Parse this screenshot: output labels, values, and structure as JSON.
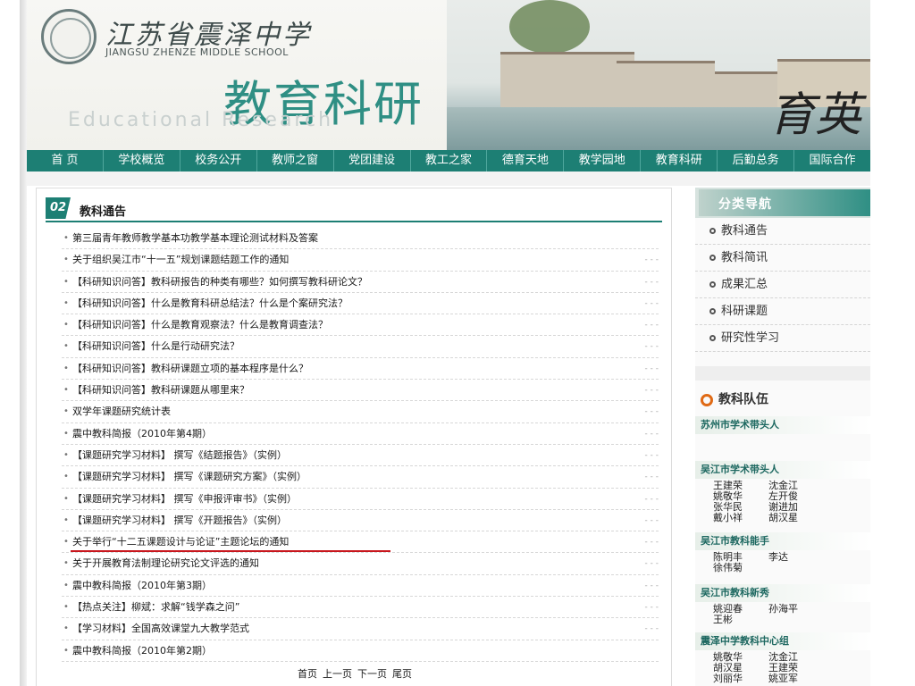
{
  "header": {
    "school_name_cn": "江苏省震泽中学",
    "school_name_en": "JIANGSU ZHENZE MIDDLE SCHOOL",
    "section_title_cn": "教育科研",
    "section_title_en": "Educational Research",
    "art_text": "育英"
  },
  "nav": {
    "items": [
      "首 页",
      "学校概览",
      "校务公开",
      "教师之窗",
      "党团建设",
      "教工之家",
      "德育天地",
      "教学园地",
      "教育科研",
      "后勤总务",
      "国际合作"
    ]
  },
  "main": {
    "badge": "02",
    "title": "教科通告",
    "items": [
      "第三届青年教师教学基本功教学基本理论测试材料及答案",
      "关于组织吴江市“十一五”规划课题结题工作的通知",
      "【科研知识问答】教科研报告的种类有哪些？如何撰写教科研论文？",
      "【科研知识问答】什么是教育科研总结法？什么是个案研究法？",
      "【科研知识问答】什么是教育观察法？什么是教育调查法？",
      "【科研知识问答】什么是行动研究法？",
      "【科研知识问答】教科研课题立项的基本程序是什么？",
      "【科研知识问答】教科研课题从哪里来？",
      "双学年课题研究统计表",
      "震中教科简报（2010年第4期）",
      "【课题研究学习材料】 撰写《结题报告》（实例）",
      "【课题研究学习材料】 撰写《课题研究方案》（实例）",
      "【课题研究学习材料】 撰写《申报评审书》（实例）",
      "【课题研究学习材料】 撰写《开题报告》（实例）",
      "关于举行“十二五课题设计与论证”主题论坛的通知",
      "关于开展教育法制理论研究论文评选的通知",
      "震中教科简报（2010年第3期）",
      "【热点关注】柳斌：求解“钱学森之问”",
      "【学习材料】全国高效课堂九大教学范式",
      "震中教科简报（2010年第2期）"
    ],
    "highlight_index": 14,
    "pager": [
      "首页",
      "上一页",
      "下一页",
      "尾页"
    ]
  },
  "sidebar": {
    "category_title": "分类导航",
    "categories": [
      "教科通告",
      "教科简讯",
      "成果汇总",
      "科研课题",
      "研究性学习"
    ],
    "team_title": "教科队伍",
    "groups": [
      {
        "title": "苏州市学术带头人",
        "rows": []
      },
      {
        "title": "吴江市学术带头人",
        "rows": [
          [
            "王建荣",
            "沈金江"
          ],
          [
            "姚敬华",
            "左开俊"
          ],
          [
            "张华民",
            "谢进加"
          ],
          [
            "戴小祥",
            "胡汉星"
          ]
        ]
      },
      {
        "title": "吴江市教科能手",
        "rows": [
          [
            "陈明丰",
            "李达"
          ],
          [
            "徐伟菊",
            ""
          ]
        ]
      },
      {
        "title": "吴江市教科新秀",
        "rows": [
          [
            "姚迎春",
            "孙海平"
          ],
          [
            "王彬",
            ""
          ]
        ]
      },
      {
        "title": "震泽中学教科中心组",
        "rows": [
          [
            "姚敬华",
            "沈金江"
          ],
          [
            "胡汉星",
            "王建荣"
          ],
          [
            "刘丽华",
            "姚亚军"
          ]
        ]
      }
    ]
  },
  "colors": {
    "accent": "#1d7f74",
    "highlight_underline": "#c8161d",
    "ring": "#e06a15"
  }
}
